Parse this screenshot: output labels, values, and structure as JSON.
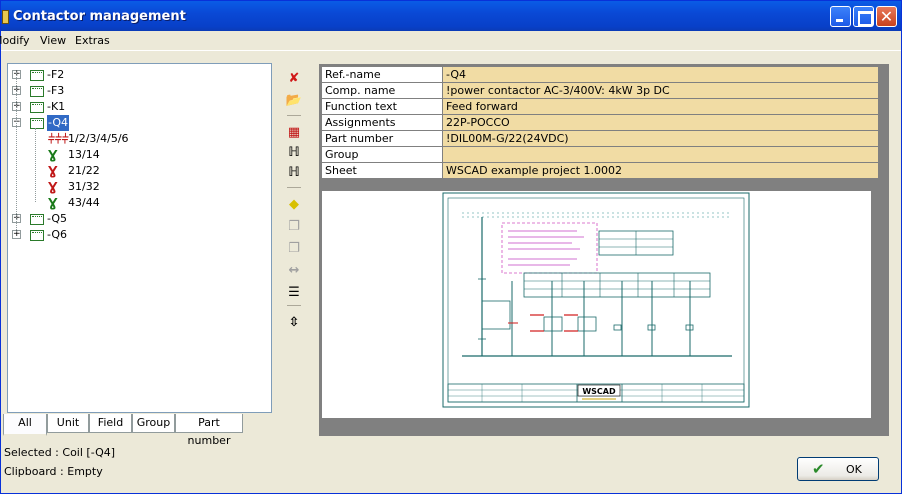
{
  "window": {
    "title": "Contactor management"
  },
  "menu": [
    {
      "label": "Modify"
    },
    {
      "label": "View"
    },
    {
      "label": "Extras"
    }
  ],
  "tree": {
    "items": [
      {
        "label": "-F2",
        "expander": "+"
      },
      {
        "label": "-F3",
        "expander": "+"
      },
      {
        "label": "-K1",
        "expander": "+"
      },
      {
        "label": "-Q4",
        "expander": "−",
        "selected": true
      },
      {
        "label": "1/2/3/4/5/6",
        "icon": "main-contacts-icon"
      },
      {
        "label": "13/14",
        "icon": "no-contact-icon"
      },
      {
        "label": "21/22",
        "icon": "nc-contact-icon"
      },
      {
        "label": "31/32",
        "icon": "nc-contact-icon"
      },
      {
        "label": "43/44",
        "icon": "no-contact-icon"
      },
      {
        "label": "-Q5",
        "expander": "+"
      },
      {
        "label": "-Q6",
        "expander": "+"
      }
    ]
  },
  "tabs": [
    {
      "label": "All",
      "active": true
    },
    {
      "label": "Unit"
    },
    {
      "label": "Field"
    },
    {
      "label": "Group"
    },
    {
      "label": "Part number"
    }
  ],
  "status": {
    "selected": "Selected : Coil [-Q4]",
    "clipboard": "Clipboard : Empty"
  },
  "toolbar": [
    {
      "icon": "delete-icon",
      "glyph": "✘",
      "color": "#d01818"
    },
    {
      "icon": "open-folder-icon",
      "glyph": "📂",
      "color": "#c8a000"
    },
    {
      "icon": "table-icon",
      "glyph": "▦",
      "color": "#c01010"
    },
    {
      "icon": "contact-symbol-icon",
      "glyph": "ℍ",
      "color": "#000"
    },
    {
      "icon": "contact-symbol-edit-icon",
      "glyph": "ℍ",
      "color": "#000"
    },
    {
      "icon": "eraser-icon",
      "glyph": "◆",
      "color": "#d8c000"
    },
    {
      "icon": "copy-icon",
      "glyph": "❐",
      "color": "#a0a0a0"
    },
    {
      "icon": "paste-icon",
      "glyph": "❐",
      "color": "#a0a0a0"
    },
    {
      "icon": "swap-icon",
      "glyph": "↔",
      "color": "#a0a0a0"
    },
    {
      "icon": "settings-icon",
      "glyph": "☰",
      "color": "#000"
    },
    {
      "icon": "resize-icon",
      "glyph": "⇳",
      "color": "#000"
    }
  ],
  "properties": [
    {
      "key": "Ref.-name",
      "value": "-Q4"
    },
    {
      "key": "Comp. name",
      "value": "!power contactor AC-3/400V: 4kW 3p DC"
    },
    {
      "key": "Function text",
      "value": "Feed forward"
    },
    {
      "key": "Assignments",
      "value": "22P-POCCO"
    },
    {
      "key": "Part number",
      "value": "!DIL00M-G/22(24VDC)"
    },
    {
      "key": "Group",
      "value": ""
    },
    {
      "key": "Sheet",
      "value": "WSCAD example project 1.0002"
    }
  ],
  "preview": {
    "logo": "WSCAD"
  },
  "buttons": {
    "ok": "OK"
  }
}
